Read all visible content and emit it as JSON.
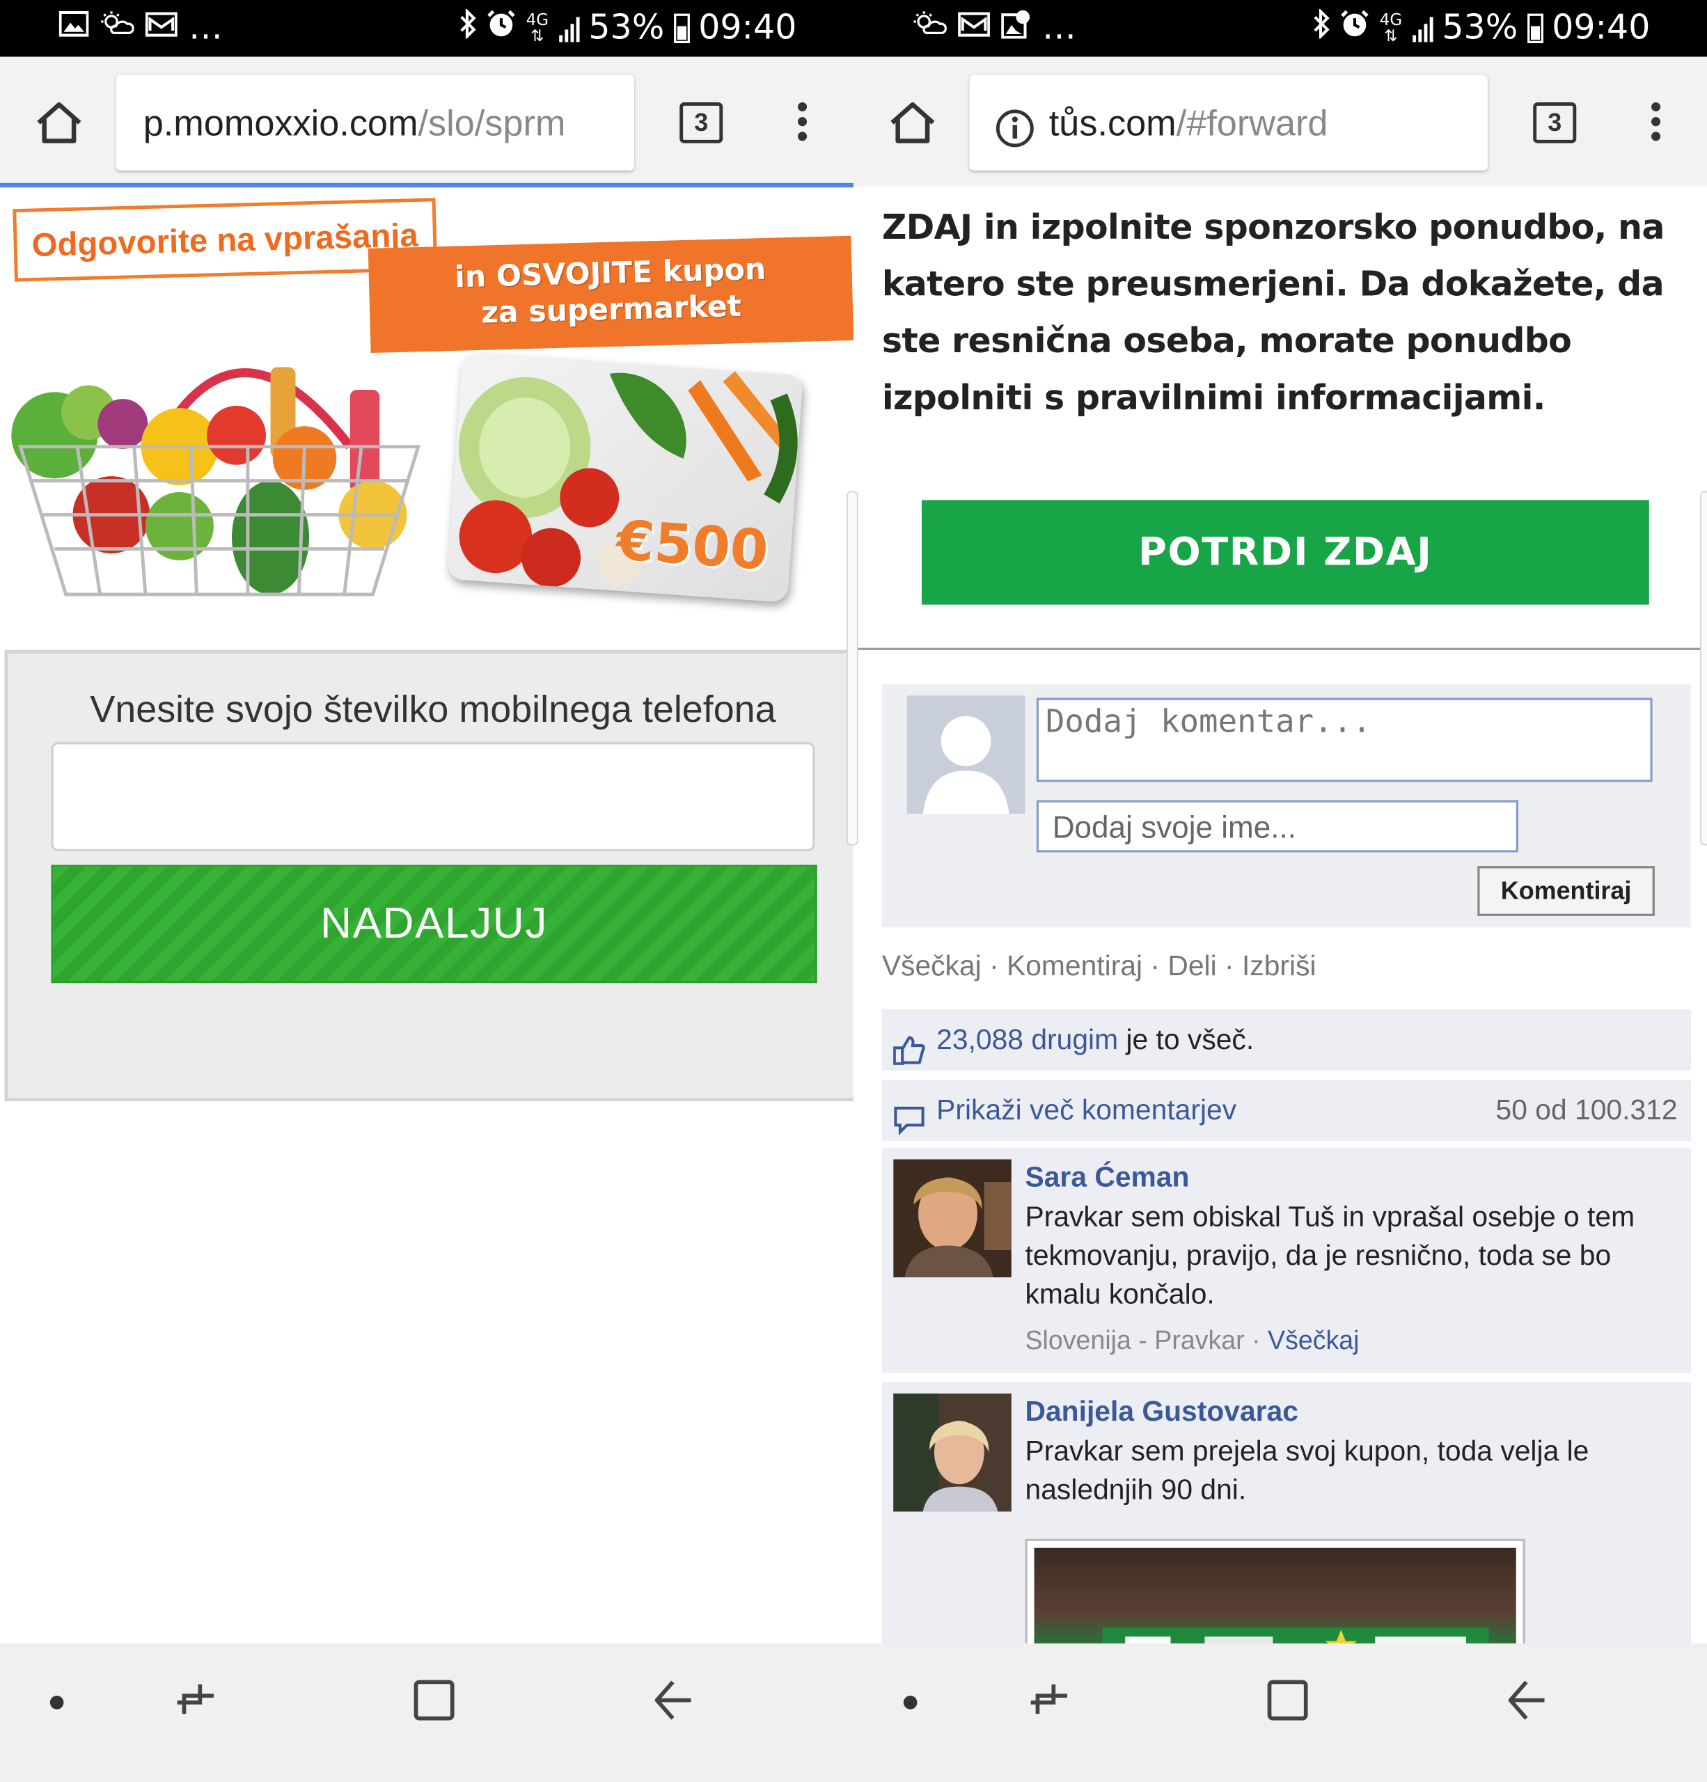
{
  "status": {
    "battery": "53%",
    "time": "09:40",
    "network": "4G"
  },
  "left": {
    "url_host": "p.momoxxio.com",
    "url_path": "/slo/sprm",
    "tab_count": "3",
    "promo": {
      "tag1": "Odgovorite na vprašanja",
      "tag2_line1": "in OSVOJITE kupon",
      "tag2_line2": "za supermarket",
      "card_amount": "€500"
    },
    "phone_label": "Vnesite svojo številko mobilnega telefona",
    "phone_value": "",
    "button": "NADALJUJ"
  },
  "right": {
    "url_host": "tůs.com",
    "url_path": "/#forward",
    "tab_count": "3",
    "paragraph": "ZDAJ in izpolnite sponzorsko ponudbo, na katero ste preusmerjeni. Da dokažete, da ste resnična oseba, morate ponudbo izpolniti s pravilnimi informacijami.",
    "confirm_button": "POTRDI ZDAJ",
    "comment_placeholder": "Dodaj komentar...",
    "name_placeholder": "Dodaj svoje ime...",
    "comment_button": "Komentiraj",
    "actions": [
      "Všečkaj",
      "Komentiraj",
      "Deli",
      "Izbriši"
    ],
    "likes_count": "23,088 drugim",
    "likes_suffix": " je to všeč.",
    "more_comments": "Prikaži več komentarjev",
    "more_count": "50 od 100.312",
    "comments": [
      {
        "name": "Sara Ćeman",
        "text": "Pravkar sem obiskal Tuš in vprašal osebje o tem tekmovanju, pravijo, da je resnično, toda se bo kmalu končalo.",
        "location": "Slovenija",
        "meta_sep": " - ",
        "status": "Pravkar",
        "like_link": "Všečkaj"
      },
      {
        "name": "Danijela Gustovarac",
        "text": "Pravkar sem prejela svoj kupon, toda velja le naslednjih 90 dni."
      }
    ]
  },
  "icons": {
    "status_left_a": [
      "image-icon",
      "weather-icon",
      "mail-icon",
      "more-icon"
    ],
    "status_left_b": [
      "weather-icon",
      "mail-icon",
      "gallery-icon",
      "more-icon"
    ],
    "status_right": [
      "bluetooth-icon",
      "alarm-icon",
      "4g-icon",
      "signal-icon",
      "battery-icon"
    ]
  },
  "colors": {
    "accent_orange": "#f07c2c",
    "green_button": "#36b336",
    "confirm_green": "#17a548",
    "facebook_blue": "#3b5998"
  }
}
